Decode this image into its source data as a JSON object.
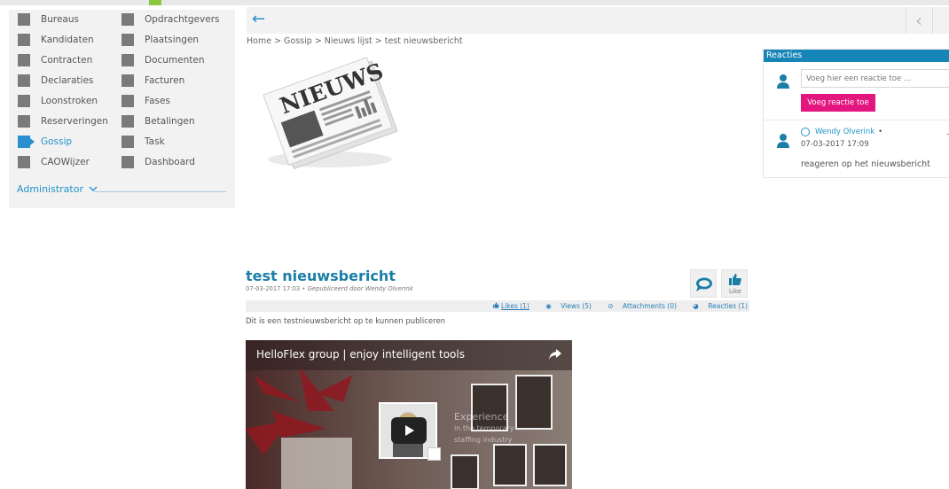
{
  "nav": {
    "col1": [
      {
        "label": "Bureaus"
      },
      {
        "label": "Kandidaten"
      },
      {
        "label": "Contracten"
      },
      {
        "label": "Declaraties"
      },
      {
        "label": "Loonstroken"
      },
      {
        "label": "Reserveringen"
      },
      {
        "label": "Gossip",
        "active": true
      },
      {
        "label": "CAOWijzer"
      }
    ],
    "col2": [
      {
        "label": "Opdrachtgevers"
      },
      {
        "label": "Plaatsingen"
      },
      {
        "label": "Documenten"
      },
      {
        "label": "Facturen"
      },
      {
        "label": "Fases"
      },
      {
        "label": "Betalingen"
      },
      {
        "label": "Task"
      },
      {
        "label": "Dashboard"
      }
    ],
    "admin_label": "Administrator",
    "active_color": "#2293c9"
  },
  "breadcrumb": "Home > Gossip > Nieuws lijst > test nieuwsbericht",
  "news_image_text": "NIEUWS",
  "comments": {
    "header": "Reacties",
    "input_placeholder": "Voeg hier een reactie toe ...",
    "submit_label": "Voeg reactie toe",
    "items": [
      {
        "author": "Wendy Olverink",
        "separator": "•",
        "date": "07-03-2017 17:09",
        "text": "reageren op het nieuwsbericht"
      }
    ]
  },
  "article": {
    "title": "test nieuwsbericht",
    "date": "07-03-2017 17:03",
    "published_by": "Gepubliceerd door Wendy Olverink",
    "like_label": "Like",
    "stats": {
      "likes": "Likes (1)",
      "views": "Views (5)",
      "attachments": "Attachments (0)",
      "reacties": "Reacties (1)"
    },
    "body": "Dit is een testnieuwsbericht op te kunnen publiceren"
  },
  "video": {
    "title": "HelloFlex group | enjoy intelligent tools",
    "overlay_main": "Experience",
    "overlay_line1": "in the temporary",
    "overlay_line2": "staffing industry"
  },
  "colors": {
    "accent_blue": "#1685b8",
    "pink_button": "#e3167f",
    "brand_green": "#8dc63f"
  }
}
